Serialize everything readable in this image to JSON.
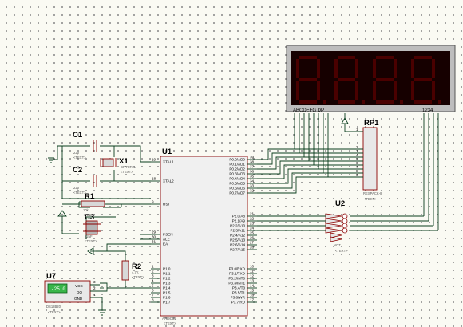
{
  "display": {
    "label_left": "ABCDEFG  DP",
    "label_right": "1234"
  },
  "rp1": {
    "ref": "RP1",
    "value": "RESPACK-8",
    "text": "<TEXT>"
  },
  "c1": {
    "ref": "C1",
    "value": "22p",
    "text": "<TEXT>"
  },
  "c2": {
    "ref": "C2",
    "value": "22p",
    "text": "<TEXT>"
  },
  "c3": {
    "ref": "C3",
    "value": "22uF",
    "text": "<TEXT>"
  },
  "x1": {
    "ref": "X1",
    "value": "CRYSTAL",
    "text": "<TEXT>"
  },
  "r1": {
    "ref": "R1",
    "value": "10k",
    "text": "<TEXT>"
  },
  "r2": {
    "ref": "R2",
    "value": "4.7K",
    "text": "<TEXT>"
  },
  "u1": {
    "ref": "U1",
    "part": "AT89C51",
    "text": "<TEXT>",
    "left_pins": [
      {
        "num": "19",
        "name": "XTAL1"
      },
      {
        "num": "18",
        "name": "XTAL2"
      },
      {
        "num": "9",
        "name": "RST"
      },
      {
        "num": "29",
        "name": "PSEN"
      },
      {
        "num": "30",
        "name": "ALE"
      },
      {
        "num": "31",
        "name": "EA"
      },
      {
        "num": "1",
        "name": "P1.0"
      },
      {
        "num": "2",
        "name": "P1.1"
      },
      {
        "num": "3",
        "name": "P1.2"
      },
      {
        "num": "4",
        "name": "P1.3"
      },
      {
        "num": "5",
        "name": "P1.4"
      },
      {
        "num": "6",
        "name": "P1.5"
      },
      {
        "num": "7",
        "name": "P1.6"
      },
      {
        "num": "8",
        "name": "P1.7"
      }
    ],
    "right_pins_p0": [
      {
        "num": "39",
        "name": "P0.0/AD0"
      },
      {
        "num": "38",
        "name": "P0.1/AD1"
      },
      {
        "num": "37",
        "name": "P0.2/AD2"
      },
      {
        "num": "36",
        "name": "P0.3/AD3"
      },
      {
        "num": "35",
        "name": "P0.4/AD4"
      },
      {
        "num": "34",
        "name": "P0.5/AD5"
      },
      {
        "num": "33",
        "name": "P0.6/AD6"
      },
      {
        "num": "32",
        "name": "P0.7/AD7"
      }
    ],
    "right_pins_p2": [
      {
        "num": "21",
        "name": "P2.0/A8"
      },
      {
        "num": "22",
        "name": "P2.1/A9"
      },
      {
        "num": "23",
        "name": "P2.2/A10"
      },
      {
        "num": "24",
        "name": "P2.3/A11"
      },
      {
        "num": "25",
        "name": "P2.4/A12"
      },
      {
        "num": "26",
        "name": "P2.5/A13"
      },
      {
        "num": "27",
        "name": "P2.6/A14"
      },
      {
        "num": "28",
        "name": "P2.7/A15"
      }
    ],
    "right_pins_p3": [
      {
        "num": "10",
        "name": "P3.0/RXD"
      },
      {
        "num": "11",
        "name": "P3.1/TXD"
      },
      {
        "num": "12",
        "name": "P3.2/INT0"
      },
      {
        "num": "13",
        "name": "P3.3/INT1"
      },
      {
        "num": "14",
        "name": "P3.4/T0"
      },
      {
        "num": "15",
        "name": "P3.5/T1"
      },
      {
        "num": "16",
        "name": "P3.6/WR"
      },
      {
        "num": "17",
        "name": "P3.7/RD"
      }
    ]
  },
  "u2": {
    "ref": "U2",
    "part": "NOT",
    "text": "<TEXT>"
  },
  "u7": {
    "ref": "U7",
    "part": "DS18B20",
    "text": "<TEXT>",
    "reading": "-25.0",
    "pins": [
      {
        "num": "3",
        "name": "VCC"
      },
      {
        "num": "2",
        "name": "DQ"
      },
      {
        "num": "1",
        "name": "GND"
      }
    ]
  }
}
